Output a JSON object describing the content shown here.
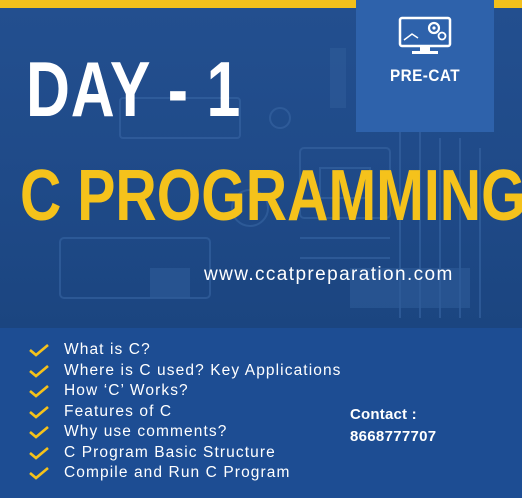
{
  "badge": {
    "icon": "monitor-gear-icon",
    "text": "PRE-CAT"
  },
  "hero": {
    "day": "DAY - 1",
    "subject": "C PROGRAMMING",
    "website": "www.ccatpreparation.com"
  },
  "topics": [
    "What is C?",
    "Where is C used? Key Applications",
    "How ‘C’ Works?",
    "Features of C",
    "Why use comments?",
    "C Program Basic Structure",
    "Compile and Run C Program"
  ],
  "contact": {
    "label": "Contact :",
    "phone": "8668777707"
  },
  "colors": {
    "accent": "#f5c21b",
    "background": "#1d4d93",
    "badge": "#2e62ab"
  }
}
